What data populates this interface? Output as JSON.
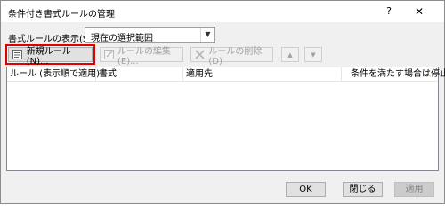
{
  "window": {
    "title": "条件付き書式ルールの管理",
    "help_glyph": "?",
    "close_glyph": "✕"
  },
  "scope": {
    "label": "書式ルールの表示(S):",
    "selected": "現在の選択範囲"
  },
  "toolbar": {
    "new_rule": "新規ルール(N)...",
    "edit_rule": "ルールの編集(E)...",
    "delete_rule": "ルールの削除(D)"
  },
  "table": {
    "columns": [
      "ルール (表示順で適用)",
      "書式",
      "適用先",
      "条件を満たす場合は停止"
    ]
  },
  "footer": {
    "ok": "OK",
    "close": "閉じる",
    "apply": "適用"
  }
}
